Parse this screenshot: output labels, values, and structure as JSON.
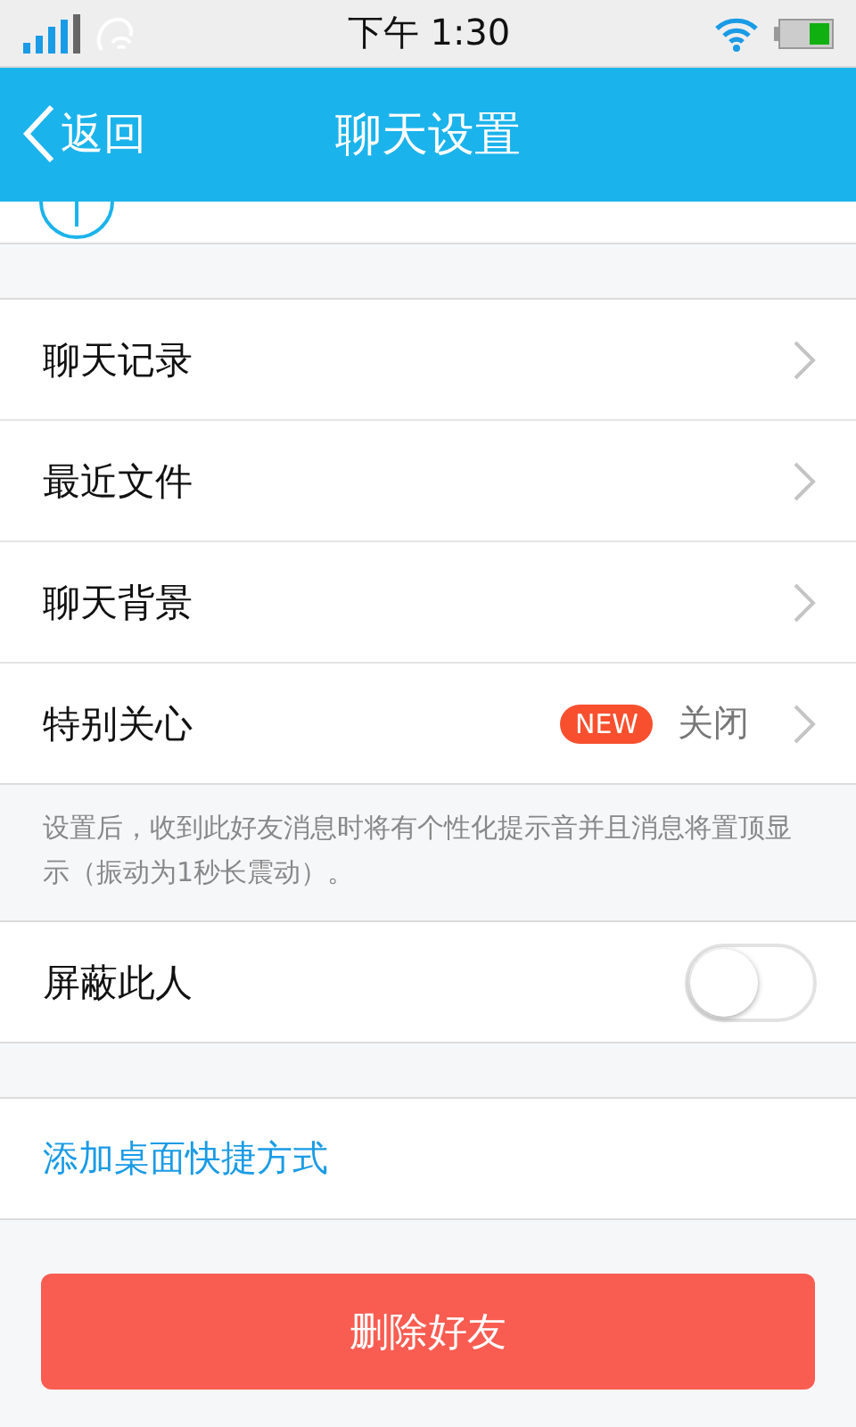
{
  "status_bar": {
    "time": "下午 1:30"
  },
  "nav": {
    "back": "返回",
    "title": "聊天设置"
  },
  "menu": [
    {
      "label": "聊天记录"
    },
    {
      "label": "最近文件"
    },
    {
      "label": "聊天背景"
    },
    {
      "label": "特别关心",
      "badge": "NEW",
      "value": "关闭"
    }
  ],
  "note": "设置后，收到此好友消息时将有个性化提示音并且消息将置顶显示（振动为1秒长震动）。",
  "block": {
    "label": "屏蔽此人",
    "on": false
  },
  "shortcut": "添加桌面快捷方式",
  "delete_button": "删除好友"
}
